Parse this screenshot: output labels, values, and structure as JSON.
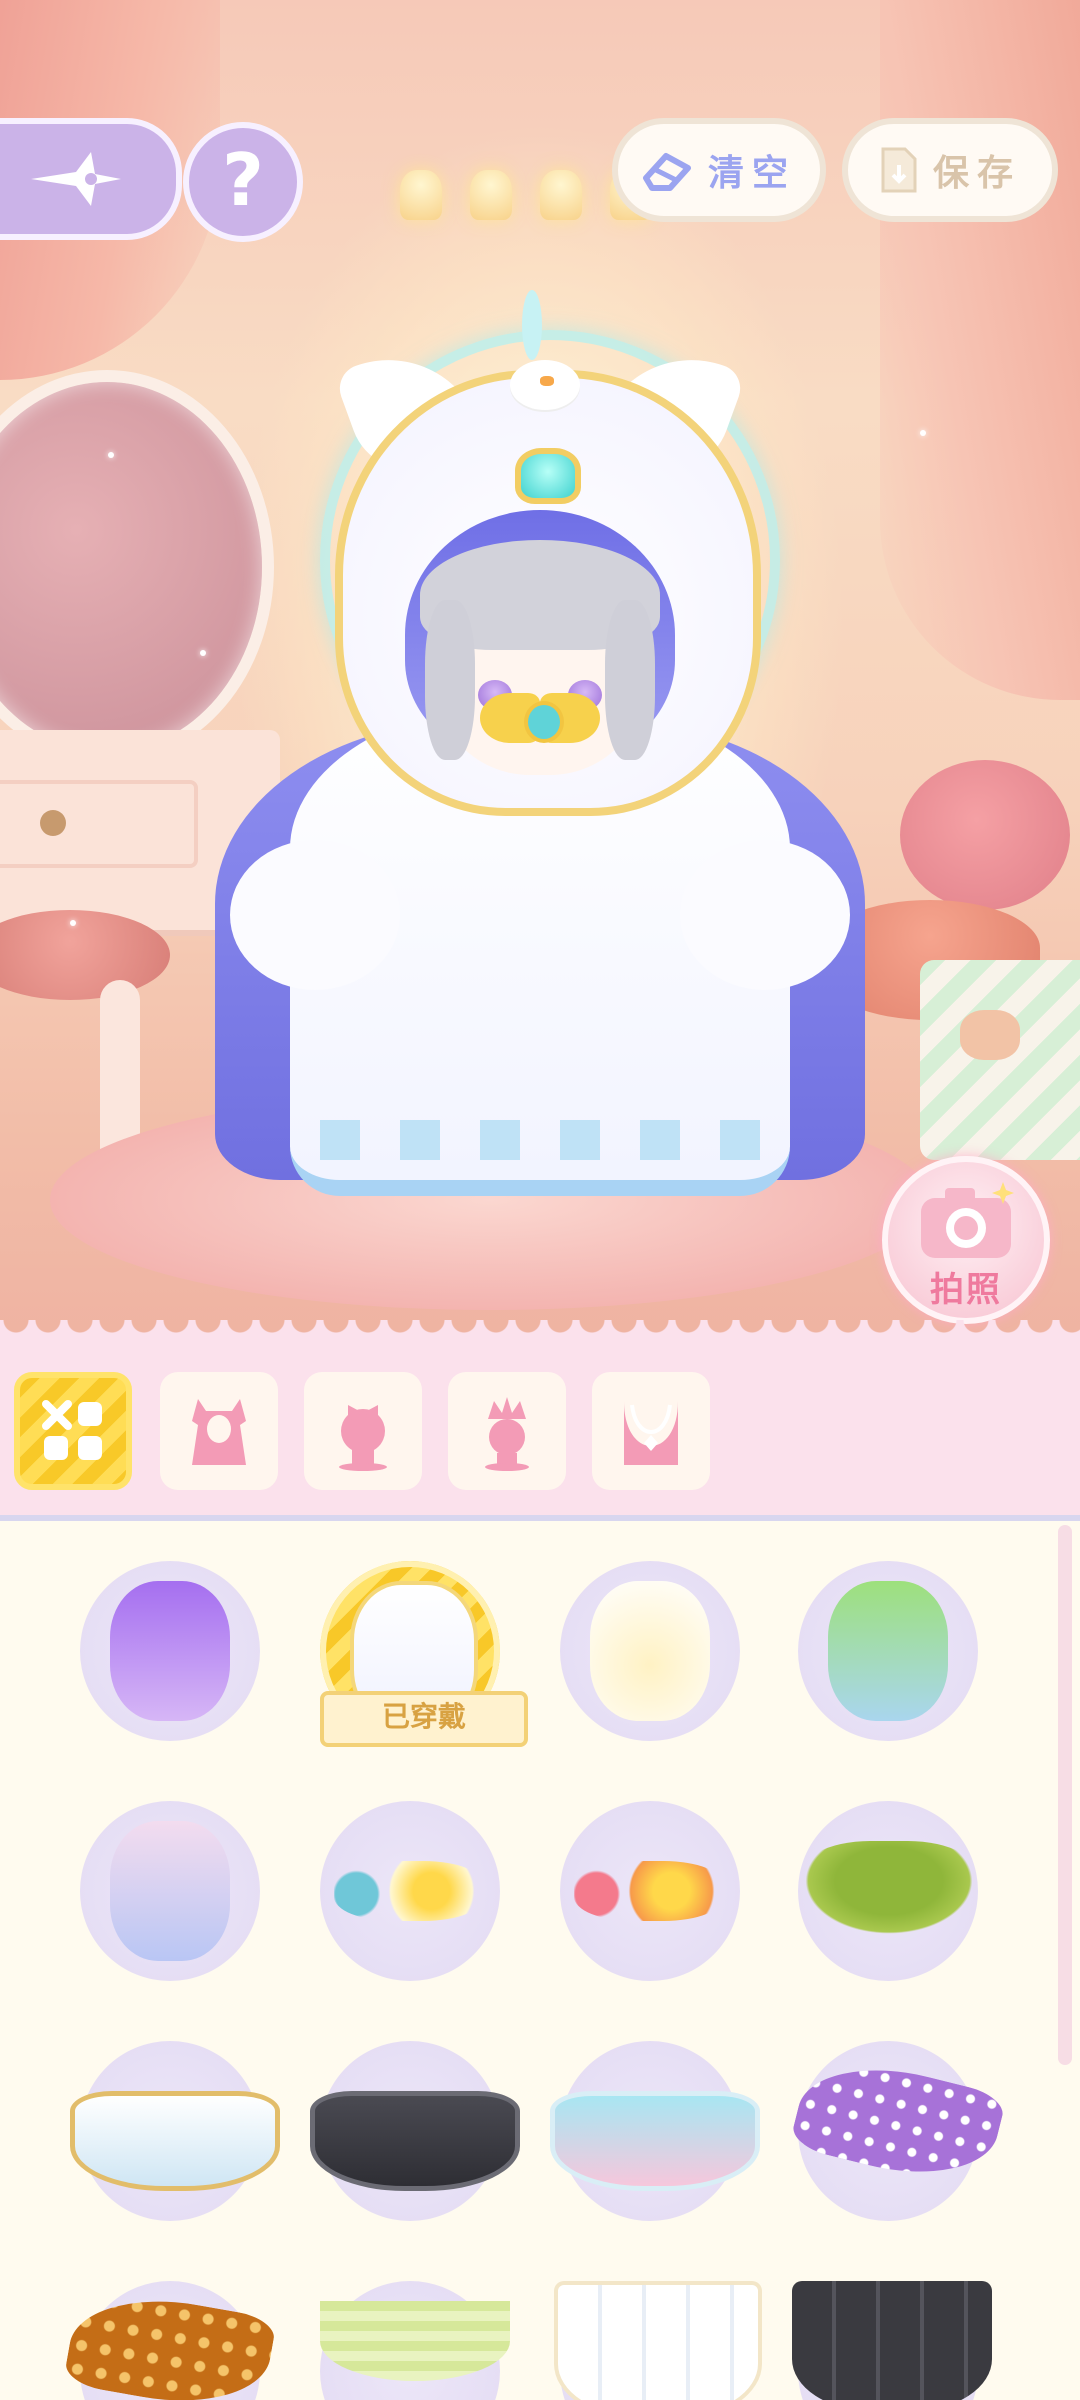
{
  "toolbar": {
    "back_icon": "wand-star-icon",
    "help_label": "?",
    "clear_label": "清空",
    "clear_icon": "eraser-icon",
    "save_label": "保存",
    "save_icon": "file-icon"
  },
  "photo": {
    "label": "拍照",
    "icon": "camera-icon"
  },
  "categories": [
    {
      "name": "all-icon",
      "selected": true
    },
    {
      "name": "outfit-icon",
      "selected": false
    },
    {
      "name": "hair-bow-icon",
      "selected": false
    },
    {
      "name": "headwear-icon",
      "selected": false
    },
    {
      "name": "necklace-icon",
      "selected": false
    }
  ],
  "items": [
    {
      "name": "purple-hood-cloak",
      "worn": false
    },
    {
      "name": "white-cat-hood-cloak",
      "worn": true,
      "badge": "已穿戴"
    },
    {
      "name": "cat-penguin-costume",
      "worn": false
    },
    {
      "name": "frog-costume",
      "worn": false
    },
    {
      "name": "hamster-costume",
      "worn": false
    },
    {
      "name": "egg-flower-hairclip-blue",
      "worn": false
    },
    {
      "name": "egg-flower-hairclip-pink",
      "worn": false
    },
    {
      "name": "green-sun-hat",
      "worn": false
    },
    {
      "name": "gold-trim-teacup",
      "worn": false
    },
    {
      "name": "black-teacup",
      "worn": false
    },
    {
      "name": "pastel-teacup",
      "worn": false
    },
    {
      "name": "purple-polka-shoe",
      "worn": false
    },
    {
      "name": "brown-polka-shoe",
      "worn": false
    },
    {
      "name": "green-plaid-collar",
      "worn": false
    },
    {
      "name": "poker-card-collar-white",
      "worn": false
    },
    {
      "name": "poker-card-collar-black",
      "worn": false
    }
  ],
  "colors": {
    "accent_yellow": "#f8c928",
    "lavender": "#cbb3e8",
    "pink_bar": "#fbe1ec",
    "panel_bg": "#fffbef"
  }
}
